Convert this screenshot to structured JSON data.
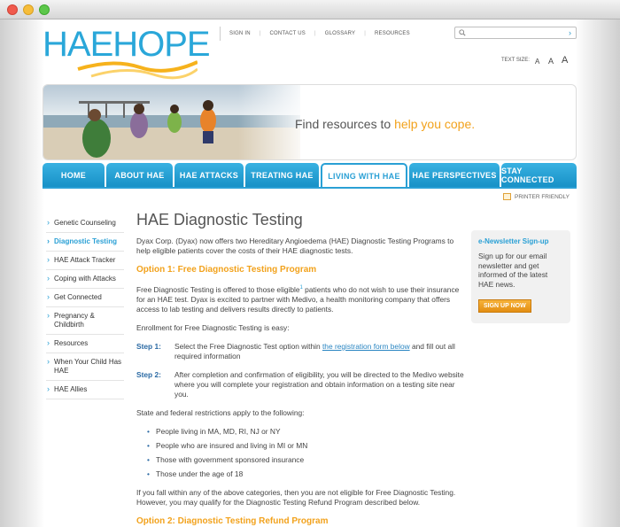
{
  "site": {
    "logo_text": "HAEHOPE",
    "util_nav": [
      "SIGN IN",
      "CONTACT US",
      "GLOSSARY",
      "RESOURCES"
    ],
    "search_placeholder": "",
    "text_size_label": "TEXT SIZE:",
    "text_size_options": [
      "A",
      "A",
      "A"
    ]
  },
  "hero": {
    "tagline_prefix": "Find resources to ",
    "tagline_highlight": "help you cope."
  },
  "main_nav": [
    {
      "label": "HOME",
      "active": false
    },
    {
      "label": "ABOUT HAE",
      "active": false
    },
    {
      "label": "HAE ATTACKS",
      "active": false
    },
    {
      "label": "TREATING HAE",
      "active": false
    },
    {
      "label": "LIVING WITH HAE",
      "active": true
    },
    {
      "label": "HAE PERSPECTIVES",
      "active": false
    },
    {
      "label": "STAY CONNECTED",
      "active": false
    }
  ],
  "printer_friendly": "PRINTER FRIENDLY",
  "sidebar": [
    {
      "label": "Genetic Counseling",
      "active": false
    },
    {
      "label": "Diagnostic Testing",
      "active": true
    },
    {
      "label": "HAE Attack Tracker",
      "active": false
    },
    {
      "label": "Coping with Attacks",
      "active": false
    },
    {
      "label": "Get Connected",
      "active": false
    },
    {
      "label": "Pregnancy & Childbirth",
      "active": false
    },
    {
      "label": "Resources",
      "active": false
    },
    {
      "label": "When Your Child Has HAE",
      "active": false
    },
    {
      "label": "HAE Allies",
      "active": false
    }
  ],
  "content": {
    "title": "HAE Diagnostic Testing",
    "intro": "Dyax Corp. (Dyax) now offers two Hereditary Angioedema (HAE) Diagnostic Testing Programs to help eligible patients cover the costs of their HAE diagnostic tests.",
    "option1_title": "Option 1: Free Diagnostic Testing Program",
    "option1_p1_a": "Free Diagnostic Testing is offered to those eligible",
    "option1_p1_sup": "1",
    "option1_p1_b": " patients who do not wish to use their insurance for an HAE test. Dyax is excited to partner with Medivo, a health monitoring company that offers access to lab testing and delivers results directly to patients.",
    "enroll_text": "Enrollment for Free Diagnostic Testing is easy:",
    "step1_label": "Step 1:",
    "step1_a": "Select the Free Diagnostic Test option within ",
    "step1_link": "the registration form below",
    "step1_b": " and fill out all required information",
    "step2_label": "Step 2:",
    "step2_text": "After completion and confirmation of eligibility, you will be directed to the Medivo website where you will complete your registration and obtain information on a testing site near you.",
    "restrictions_text": "State and federal restrictions apply to the following:",
    "restrictions": [
      "People living in MA, MD, RI, NJ or NY",
      "People who are insured and living in MI or MN",
      "Those with government sponsored insurance",
      "Those under the age of 18"
    ],
    "ineligible_text": "If you fall within any of the above categories, then you are not eligible for Free Diagnostic Testing. However, you may qualify for the Diagnostic Testing Refund Program described below.",
    "option2_title": "Option 2: Diagnostic Testing Refund Program"
  },
  "enewsletter": {
    "title": "e-Newsletter Sign-up",
    "description": "Sign up for our email newsletter and get informed of the latest HAE news.",
    "button": "SIGN UP NOW"
  },
  "colors": {
    "brand_blue": "#2aa0d5",
    "accent_orange": "#f2a21c"
  }
}
